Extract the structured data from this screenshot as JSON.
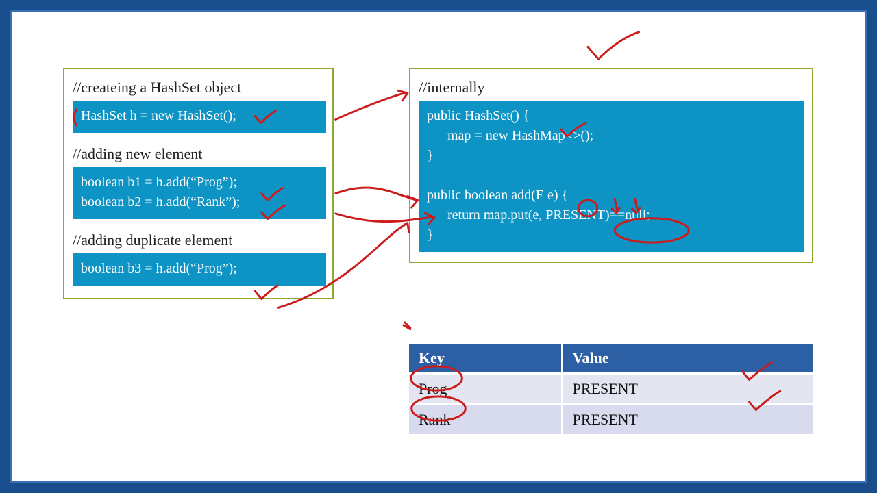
{
  "left": {
    "comment1": "//createing a HashSet object",
    "code1": "HashSet h = new HashSet();",
    "comment2": "//adding new element",
    "code2": "boolean b1 = h.add(“Prog”);\nboolean b2 = h.add(“Rank”);",
    "comment3": "//adding duplicate element",
    "code3": "boolean b3 = h.add(“Prog”);"
  },
  "right": {
    "comment1": "//internally",
    "code1": "public HashSet() {\n      map = new HashMap<>();\n}\n\npublic boolean add(E e) {\n      return map.put(e, PRESENT)==null;\n}"
  },
  "table": {
    "header_key": "Key",
    "header_value": "Value",
    "rows": [
      {
        "key": "Prog",
        "value": "PRESENT"
      },
      {
        "key": "Rank",
        "value": "PRESENT"
      }
    ]
  },
  "colors": {
    "frame_outer": "#1a4d8c",
    "frame_inner_border": "#3b6fb5",
    "box_border": "#8fa830",
    "code_bg": "#0d93c4",
    "table_header": "#2d5fa4",
    "annotation": "#cc1b1b"
  }
}
